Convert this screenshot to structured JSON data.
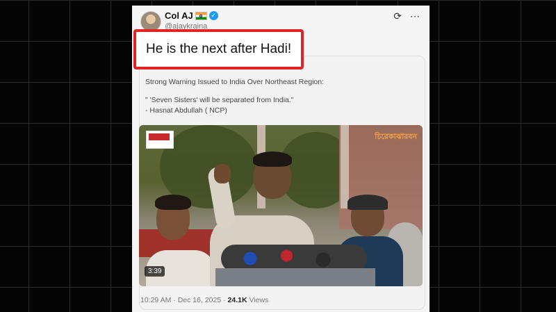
{
  "tweet": {
    "author_name": "Col AJ",
    "handle": "@ajaykraina",
    "highlight_text": "He is the next after Hadi!",
    "time": "10:29 AM",
    "separator": "·",
    "date": "Dec 16, 2025",
    "views_count": "24.1K",
    "views_label": "Views"
  },
  "quote": {
    "line1": "Strong Warning Issued to India Over Northeast Region:",
    "line2": "\" 'Seven Sisters' will be separated from India.\"",
    "line3": "- Hasnat Abdullah ( NCP)"
  },
  "video": {
    "duration": "3:39",
    "watermark": "চিরেকাঝারবন"
  },
  "icons": {
    "flag": "india-flag-icon",
    "verified": "verified-badge-icon",
    "grok": "grok-icon",
    "more": "more-icon"
  },
  "colors": {
    "highlight_border": "#e02424",
    "verified_blue": "#1d9bf0"
  }
}
